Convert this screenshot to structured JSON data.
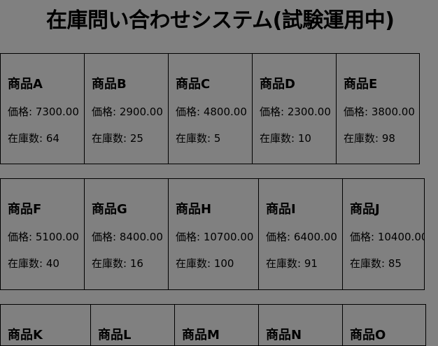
{
  "title": "在庫問い合わせシステム(試験運用中)",
  "labels": {
    "price_prefix": "価格: ",
    "stock_prefix": "在庫数: "
  },
  "rows": [
    {
      "products": [
        {
          "name": "商品A",
          "price": "7300.00",
          "stock": "64"
        },
        {
          "name": "商品B",
          "price": "2900.00",
          "stock": "25"
        },
        {
          "name": "商品C",
          "price": "4800.00",
          "stock": "5"
        },
        {
          "name": "商品D",
          "price": "2300.00",
          "stock": "10"
        },
        {
          "name": "商品E",
          "price": "3800.00",
          "stock": "98"
        }
      ]
    },
    {
      "products": [
        {
          "name": "商品F",
          "price": "5100.00",
          "stock": "40"
        },
        {
          "name": "商品G",
          "price": "8400.00",
          "stock": "16"
        },
        {
          "name": "商品H",
          "price": "10700.00",
          "stock": "100"
        },
        {
          "name": "商品I",
          "price": "6400.00",
          "stock": "91"
        },
        {
          "name": "商品J",
          "price": "10400.00",
          "stock": "85"
        }
      ]
    },
    {
      "products": [
        {
          "name": "商品K"
        },
        {
          "name": "商品L"
        },
        {
          "name": "商品M"
        },
        {
          "name": "商品N"
        },
        {
          "name": "商品O"
        }
      ]
    }
  ]
}
